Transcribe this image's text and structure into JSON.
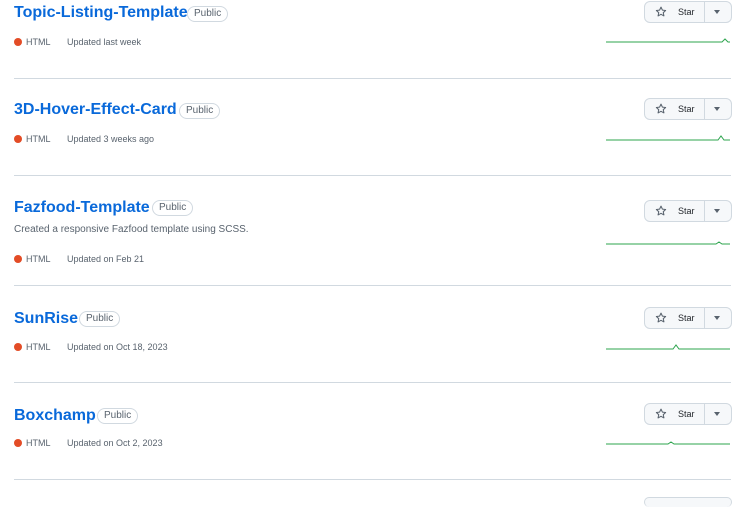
{
  "repos": [
    {
      "name": "Topic-Listing-Template",
      "visibility": "Public",
      "description": "",
      "language": "HTML",
      "language_color": "#e34c26",
      "updated": "Updated last week",
      "star_label": "Star"
    },
    {
      "name": "3D-Hover-Effect-Card",
      "visibility": "Public",
      "description": "",
      "language": "HTML",
      "language_color": "#e34c26",
      "updated": "Updated 3 weeks ago",
      "star_label": "Star"
    },
    {
      "name": "Fazfood-Template",
      "visibility": "Public",
      "description": "Created a responsive Fazfood template using SCSS.",
      "language": "HTML",
      "language_color": "#e34c26",
      "updated": "Updated on Feb 21",
      "star_label": "Star"
    },
    {
      "name": "SunRise",
      "visibility": "Public",
      "description": "",
      "language": "HTML",
      "language_color": "#e34c26",
      "updated": "Updated on Oct 18, 2023",
      "star_label": "Star"
    },
    {
      "name": "Boxchamp",
      "visibility": "Public",
      "description": "",
      "language": "HTML",
      "language_color": "#e34c26",
      "updated": "Updated on Oct 2, 2023",
      "star_label": "Star"
    }
  ],
  "colors": {
    "link": "#0969da",
    "sparkline": "#2da44e",
    "border": "#d1d9e0"
  }
}
